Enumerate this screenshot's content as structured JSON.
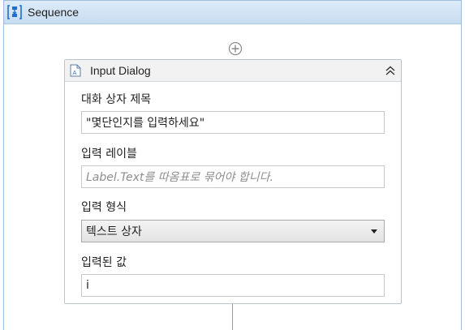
{
  "sequence": {
    "title": "Sequence",
    "icon": "sequence-icon"
  },
  "add_activity": {
    "icon": "plus-circle-icon"
  },
  "activity": {
    "title": "Input Dialog",
    "icon": "input-dialog-icon",
    "collapse_icon": "double-chevron-up-icon"
  },
  "fields": {
    "dialog_title_label": "대화 상자 제목",
    "dialog_title_value": "\"몇단인지를 입력하세요\"",
    "input_label_label": "입력 레이블",
    "input_label_placeholder": "Label.Text를 따옴표로 묶어야 합니다.",
    "input_type_label": "입력 형식",
    "input_type_value": "텍스트 상자",
    "entered_value_label": "입력된 값",
    "entered_value_value": "i"
  },
  "colors": {
    "header_blue": "#c8ddf0",
    "border_blue": "#9fbfdc",
    "icon_blue": "#1e6fd0"
  }
}
